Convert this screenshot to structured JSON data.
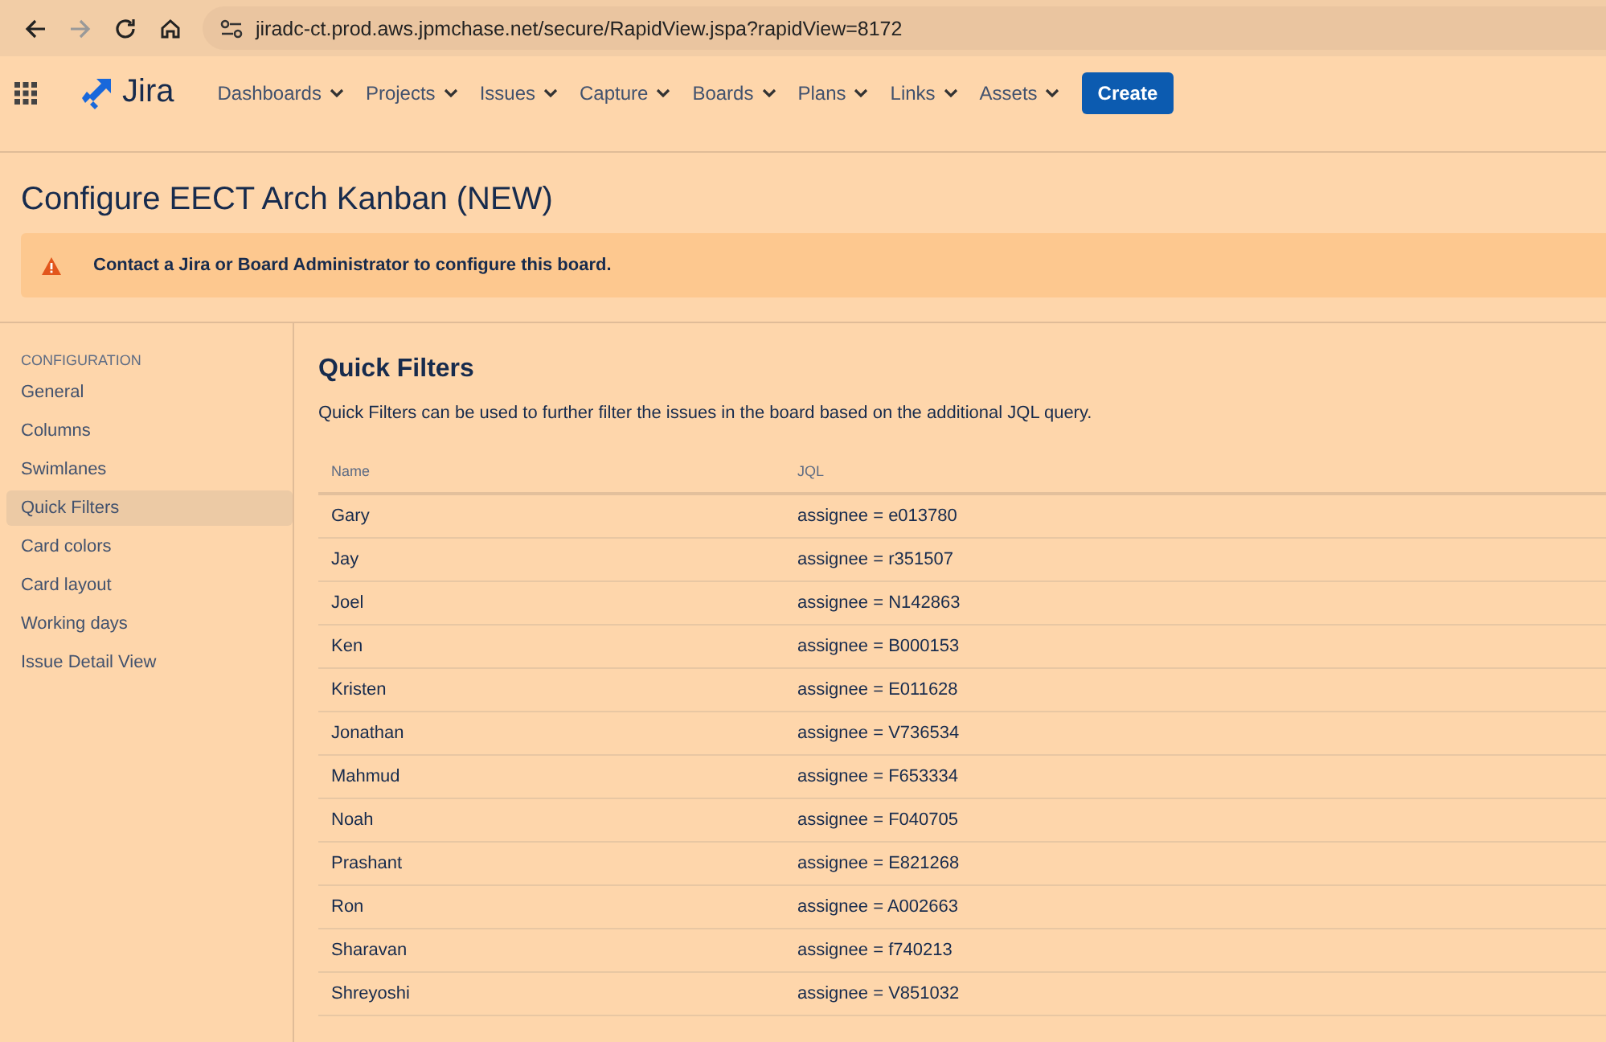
{
  "browser": {
    "url": "jiradc-ct.prod.aws.jpmchase.net/secure/RapidView.jspa?rapidView=8172"
  },
  "nav": {
    "product": "Jira",
    "menus": [
      {
        "label": "Dashboards"
      },
      {
        "label": "Projects"
      },
      {
        "label": "Issues"
      },
      {
        "label": "Capture"
      },
      {
        "label": "Boards"
      },
      {
        "label": "Plans"
      },
      {
        "label": "Links"
      },
      {
        "label": "Assets"
      }
    ],
    "create": "Create"
  },
  "page": {
    "title": "Configure EECT Arch Kanban (NEW)",
    "warning": "Contact a Jira or Board Administrator to configure this board."
  },
  "sidebar": {
    "heading": "CONFIGURATION",
    "items": [
      {
        "label": "General",
        "selected": false
      },
      {
        "label": "Columns",
        "selected": false
      },
      {
        "label": "Swimlanes",
        "selected": false
      },
      {
        "label": "Quick Filters",
        "selected": true
      },
      {
        "label": "Card colors",
        "selected": false
      },
      {
        "label": "Card layout",
        "selected": false
      },
      {
        "label": "Working days",
        "selected": false
      },
      {
        "label": "Issue Detail View",
        "selected": false
      }
    ]
  },
  "content": {
    "title": "Quick Filters",
    "description": "Quick Filters can be used to further filter the issues in the board based on the additional JQL query.",
    "table": {
      "columns": [
        "Name",
        "JQL"
      ],
      "rows": [
        {
          "name": "Gary",
          "jql": "assignee = e013780"
        },
        {
          "name": "Jay",
          "jql": "assignee = r351507"
        },
        {
          "name": "Joel",
          "jql": "assignee = N142863"
        },
        {
          "name": "Ken",
          "jql": "assignee = B000153"
        },
        {
          "name": "Kristen",
          "jql": "assignee = E011628"
        },
        {
          "name": "Jonathan",
          "jql": "assignee = V736534"
        },
        {
          "name": "Mahmud",
          "jql": "assignee = F653334"
        },
        {
          "name": "Noah",
          "jql": "assignee = F040705"
        },
        {
          "name": "Prashant",
          "jql": "assignee = E821268"
        },
        {
          "name": "Ron",
          "jql": "assignee = A002663"
        },
        {
          "name": "Sharavan",
          "jql": "assignee = f740213"
        },
        {
          "name": "Shreyoshi",
          "jql": "assignee = V851032"
        }
      ]
    }
  }
}
